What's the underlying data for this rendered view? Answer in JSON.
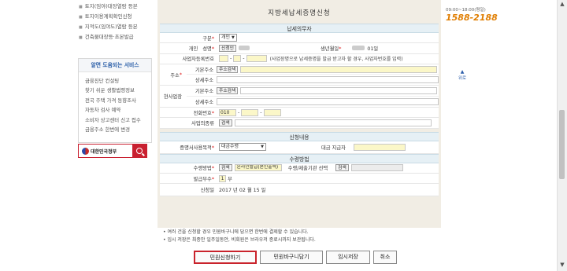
{
  "left": {
    "links": [
      "토지(임야)대장열람 등본",
      "토지이용계획확인신청",
      "지적도(임야도)열람 등본",
      "건축물대장등·초본발급"
    ],
    "service_title": "알면 도움되는 서비스",
    "services": [
      "금융진단 컨설팅",
      "찾기 쉬운 생활법령정보",
      "전국 주택 가격 동향조사",
      "자동차 검사 예약",
      "소비자 상고센터 신고 접수",
      "금융주소 한번에 변경"
    ],
    "gov_text": "대한민국정부"
  },
  "form": {
    "title": "지방세납세증명신청",
    "section_taxpayer": "납세의무자",
    "gubun_label": "구분",
    "gubun_value": "개인",
    "personal_label": "개인",
    "name_label": "성명",
    "auth_button": "신청인",
    "birth_label": "생년월일",
    "birth_suffix": "01일",
    "bizno_label": "사업자등록번호",
    "bizno_note": "(사업장명으로 납세증명을 발급 받고자 할 경우, 사업자번호를 입력)",
    "address_label": "주소",
    "base_addr_label": "기본주소",
    "addr_search_button": "주소검색",
    "detail_addr_label": "상세주소",
    "biz_place_label": "현사업장",
    "phone_label": "전화번호",
    "phone_prefix": "010",
    "biz_type_label": "사업의종류",
    "search_button": "검색",
    "section_apply": "신청내용",
    "purpose_label": "증명서사용목적",
    "purpose_value": "대금수령",
    "payer_label": "대금 지급자",
    "section_receive": "수령방법",
    "receive_label": "수령방법",
    "receive_value": "온라인발급(본인출력)",
    "agency_label": "수령/제출기관 선택",
    "copies_label": "발급부수",
    "copies_value": "1",
    "copies_unit": "부",
    "apply_date_label": "신청일",
    "apply_date_value": "2017 년 02 월 15 일"
  },
  "notes": [
    "• 여러 건을 신청할 경우 민원바구니에 담으면 한번에 결제할 수 있습니다.",
    "• 임시 저장은 최종안 일주일동안, 비회원은 브라우저 종료시까지 보관됩니다."
  ],
  "actions": {
    "apply": "민원신청하기",
    "basket": "민원바구니담기",
    "temp_save": "임시저장",
    "cancel": "취소"
  },
  "right": {
    "hours": "09:00~18:00(평일)",
    "phone": "1588-2188",
    "top_link": "위로"
  },
  "colors": {
    "accent": "#c9232c",
    "phone": "#e07d00",
    "section_bg": "#e6f0f5",
    "input_yellow": "#fbf7c8"
  }
}
